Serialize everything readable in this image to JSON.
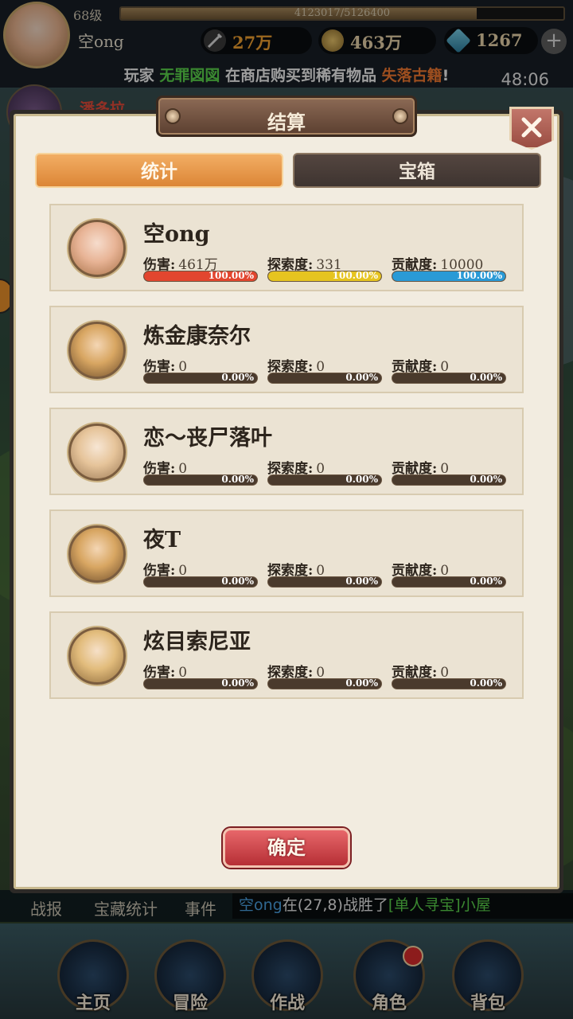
{
  "player": {
    "level": "68级",
    "exp_text": "4123017/5126400",
    "exp_fraction": 0.804,
    "name": "空ong"
  },
  "resources": [
    {
      "icon": "sword-icon",
      "value": "27万",
      "color": "#f0a030"
    },
    {
      "icon": "coin-icon",
      "value": "463万",
      "color": "#e6d2a8"
    },
    {
      "icon": "gem-icon",
      "value": "1267",
      "color": "#e6d2a8"
    }
  ],
  "broadcast": {
    "p1": "玩家 ",
    "name": "无罪図図",
    "p2": " 在商店购买到稀有物品 ",
    "item": "失落古籍",
    "p3": "!"
  },
  "timer": "48:06",
  "side": {
    "name": "潘多拉"
  },
  "modal": {
    "title": "结算",
    "tabs": [
      {
        "label": "统计",
        "active": true
      },
      {
        "label": "宝箱",
        "active": false
      }
    ],
    "stat_labels": {
      "damage": "伤害:",
      "explore": "探索度:",
      "contribution": "贡献度:"
    },
    "rows": [
      {
        "name": "空ong",
        "damage": "461万",
        "explore": "331",
        "contribution": "10000",
        "damage_pct": "100.00%",
        "explore_pct": "100.00%",
        "contribution_pct": "100.00%",
        "damage_fill": 1.0,
        "explore_fill": 1.0,
        "contribution_fill": 1.0
      },
      {
        "name": "炼金康奈尔",
        "damage": "0",
        "explore": "0",
        "contribution": "0",
        "damage_pct": "0.00%",
        "explore_pct": "0.00%",
        "contribution_pct": "0.00%",
        "damage_fill": 0,
        "explore_fill": 0,
        "contribution_fill": 0
      },
      {
        "name": "恋～丧尸落叶",
        "damage": "0",
        "explore": "0",
        "contribution": "0",
        "damage_pct": "0.00%",
        "explore_pct": "0.00%",
        "contribution_pct": "0.00%",
        "damage_fill": 0,
        "explore_fill": 0,
        "contribution_fill": 0
      },
      {
        "name": "夜T",
        "damage": "0",
        "explore": "0",
        "contribution": "0",
        "damage_pct": "0.00%",
        "explore_pct": "0.00%",
        "contribution_pct": "0.00%",
        "damage_fill": 0,
        "explore_fill": 0,
        "contribution_fill": 0
      },
      {
        "name": "炫目索尼亚",
        "damage": "0",
        "explore": "0",
        "contribution": "0",
        "damage_pct": "0.00%",
        "explore_pct": "0.00%",
        "contribution_pct": "0.00%",
        "damage_fill": 0,
        "explore_fill": 0,
        "contribution_fill": 0
      }
    ],
    "bar_colors": {
      "damage": "#e2462f",
      "explore": "#e6c420",
      "contribution": "#2a9ad6"
    },
    "confirm_label": "确定"
  },
  "log": {
    "tabs": [
      "战报",
      "宝藏统计",
      "事件"
    ],
    "msg_name": "空ong",
    "msg_text": "在(27,8)战胜了",
    "msg_target": "[单人寻宝]小屋"
  },
  "nav": [
    {
      "label": "主页",
      "badge": false
    },
    {
      "label": "冒险",
      "badge": false
    },
    {
      "label": "作战",
      "badge": false
    },
    {
      "label": "角色",
      "badge": true
    },
    {
      "label": "背包",
      "badge": false
    }
  ],
  "colors": {
    "accent": "#dc8636",
    "broadcast_name": "#5ad24a",
    "broadcast_item": "#f07830",
    "log_name": "#4aa0e0",
    "log_target": "#5ad24a"
  }
}
